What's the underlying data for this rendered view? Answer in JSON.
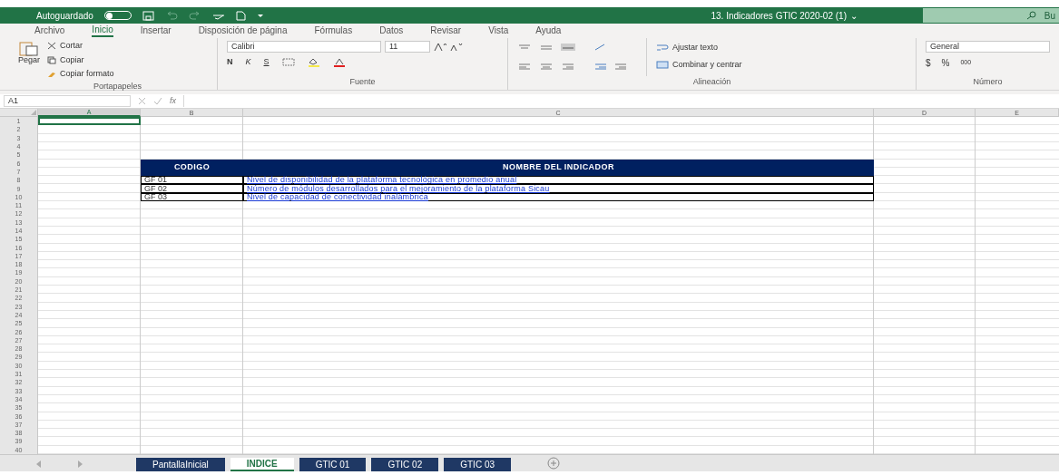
{
  "title_bar": {
    "autosave_label": "Autoguardado",
    "autosave_on": false,
    "document_title": "13. Indicadores GTIC 2020-02 (1)",
    "title_caret": "⌄",
    "search_placeholder": "Bu"
  },
  "menu_tabs": [
    {
      "label": "Archivo",
      "selected": false
    },
    {
      "label": "Inicio",
      "selected": true
    },
    {
      "label": "Insertar",
      "selected": false
    },
    {
      "label": "Disposición de página",
      "selected": false
    },
    {
      "label": "Fórmulas",
      "selected": false
    },
    {
      "label": "Datos",
      "selected": false
    },
    {
      "label": "Revisar",
      "selected": false
    },
    {
      "label": "Vista",
      "selected": false
    },
    {
      "label": "Ayuda",
      "selected": false
    }
  ],
  "ribbon": {
    "clipboard": {
      "paste": "Pegar",
      "cut": "Cortar",
      "copy": "Copiar",
      "format_painter": "Copiar formato",
      "group_label": "Portapapeles"
    },
    "font": {
      "font_name": "Calibri",
      "font_size": "11",
      "bold": "N",
      "italic": "K",
      "underline": "S",
      "group_label": "Fuente"
    },
    "alignment": {
      "wrap_text": "Ajustar texto",
      "merge_center": "Combinar y centrar",
      "group_label": "Alineación"
    },
    "number": {
      "format": "General",
      "currency": "$",
      "percent": "%",
      "thousands": "000",
      "group_label": "Número"
    }
  },
  "formula_bar": {
    "name_box": "A1",
    "fx": "fx"
  },
  "sheet": {
    "columns": [
      {
        "label": "A",
        "selected": true
      },
      {
        "label": "B",
        "selected": false
      },
      {
        "label": "C",
        "selected": false
      },
      {
        "label": "D",
        "selected": false
      },
      {
        "label": "E",
        "selected": false
      }
    ],
    "row_numbers": [
      "1",
      "2",
      "3",
      "4",
      "5",
      "6",
      "7",
      "8",
      "9",
      "10",
      "11",
      "12",
      "13",
      "14",
      "15",
      "16",
      "17",
      "18",
      "19",
      "20",
      "21",
      "22",
      "23",
      "24",
      "25",
      "26",
      "27",
      "28",
      "29",
      "30",
      "31",
      "32",
      "33",
      "34",
      "35",
      "36",
      "37",
      "38",
      "39",
      "40"
    ],
    "table": {
      "headers": [
        "CODIGO",
        "NOMBRE DEL INDICADOR"
      ],
      "rows": [
        {
          "code": "GF 01",
          "name": "Nivel de disponibilidad de la plataforma tecnológica en promedio anual"
        },
        {
          "code": "GF 02",
          "name": "Número de módulos desarrollados para el mejoramiento de la plataforma Sicau"
        },
        {
          "code": "GF 03",
          "name": "Nivel de capacidad de conectividad inalámbrica"
        }
      ]
    }
  },
  "sheet_tabs": [
    {
      "label": "PantallaInicial",
      "selected": false
    },
    {
      "label": "INDICE",
      "selected": true
    },
    {
      "label": "GTIC 01",
      "selected": false
    },
    {
      "label": "GTIC 02",
      "selected": false
    },
    {
      "label": "GTIC 03",
      "selected": false
    }
  ]
}
